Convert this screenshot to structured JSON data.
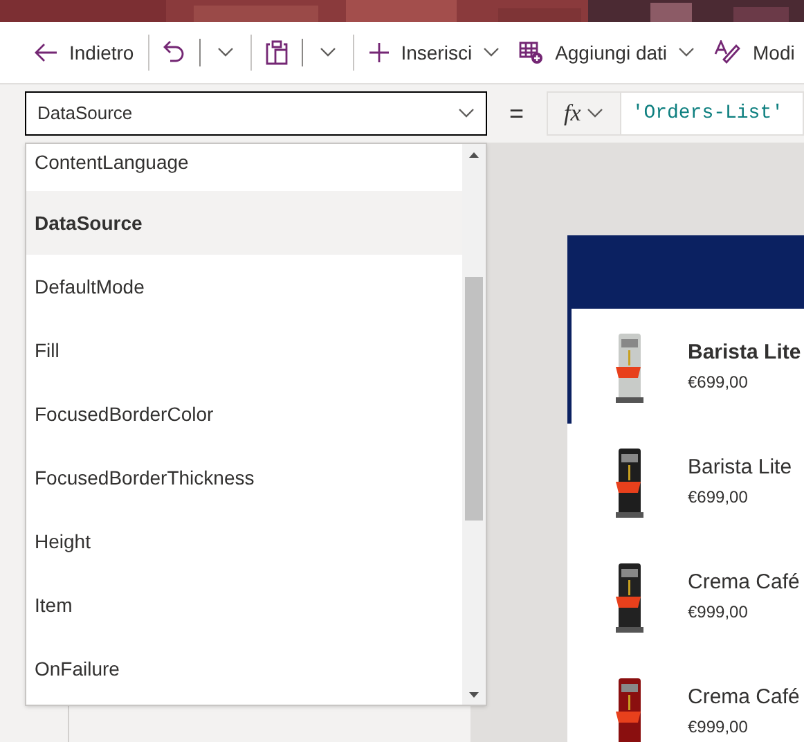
{
  "toolbar": [
    {
      "kind": "back",
      "label": "Indietro"
    },
    {
      "kind": "undo"
    },
    {
      "kind": "caret"
    },
    {
      "kind": "paste"
    },
    {
      "kind": "caret"
    },
    {
      "kind": "insert",
      "label": "Inserisci",
      "caret": true
    },
    {
      "kind": "data",
      "label": "Aggiungi dati",
      "caret": true
    },
    {
      "kind": "theme",
      "label": "Modi"
    }
  ],
  "property_select": {
    "value": "DataSource"
  },
  "equals": "=",
  "fx": "fx",
  "formula": "'Orders-List'",
  "property_list": [
    {
      "label": "ContentLanguage",
      "selected": false
    },
    {
      "label": "DataSource",
      "selected": true
    },
    {
      "label": "DefaultMode",
      "selected": false
    },
    {
      "label": "Fill",
      "selected": false
    },
    {
      "label": "FocusedBorderColor",
      "selected": false
    },
    {
      "label": "FocusedBorderThickness",
      "selected": false
    },
    {
      "label": "Height",
      "selected": false
    },
    {
      "label": "Item",
      "selected": false
    },
    {
      "label": "OnFailure",
      "selected": false
    }
  ],
  "gallery": [
    {
      "name": "Barista Lite",
      "price": "€699,00",
      "selected": true
    },
    {
      "name": "Barista Lite",
      "price": "€699,00",
      "selected": false
    },
    {
      "name": "Crema Café",
      "price": "€999,00",
      "selected": false
    },
    {
      "name": "Crema Café",
      "price": "€999,00",
      "selected": false
    }
  ]
}
